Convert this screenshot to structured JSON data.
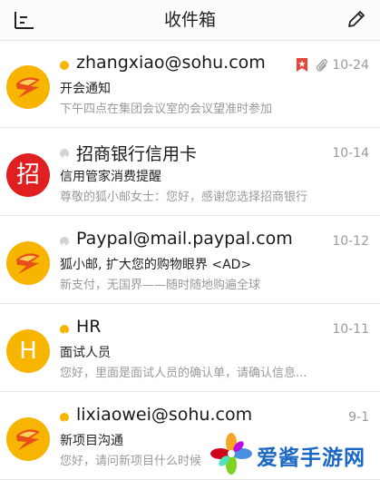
{
  "header": {
    "title": "收件箱",
    "menu_icon": "menu-icon",
    "compose_icon": "compose-icon"
  },
  "colors": {
    "accent": "#f7b500",
    "unread_dot": "#f7b500",
    "flag": "#e8453c",
    "bank_red": "#e02020"
  },
  "emails": [
    {
      "sender": "zhangxiao@sohu.com",
      "subject": "开会通知",
      "preview": "下午四点在集团会议室的会议望准时参加",
      "date": "10-24",
      "status": "unread",
      "flagged": true,
      "attachment": true,
      "avatar": "sohu-logo"
    },
    {
      "sender": "招商银行信用卡",
      "subject": "信用管家消费提醒",
      "preview": "尊敬的狐小邮女士：您好，感谢您选择招商银行",
      "date": "10-14",
      "status": "forwarded",
      "avatar_text": "招"
    },
    {
      "sender": "Paypal@mail.paypal.com",
      "subject": "狐小邮, 扩大您的购物眼界 <AD>",
      "preview": "新支付，无国界——随时随地购遍全球",
      "date": "10-12",
      "status": "forwarded",
      "avatar": "sohu-logo"
    },
    {
      "sender": "HR",
      "subject": "面试人员",
      "preview": "您好，里面是面试人员的确认单，请确认信息...",
      "date": "10-11",
      "status": "replied",
      "avatar_text": "H"
    },
    {
      "sender": "lixiaowei@sohu.com",
      "subject": "新项目沟通",
      "preview": "您好，请问新项目什么时候",
      "date": "9-1",
      "status": "replied",
      "avatar": "sohu-logo"
    }
  ],
  "watermark": {
    "text": "爱酱手游网"
  }
}
